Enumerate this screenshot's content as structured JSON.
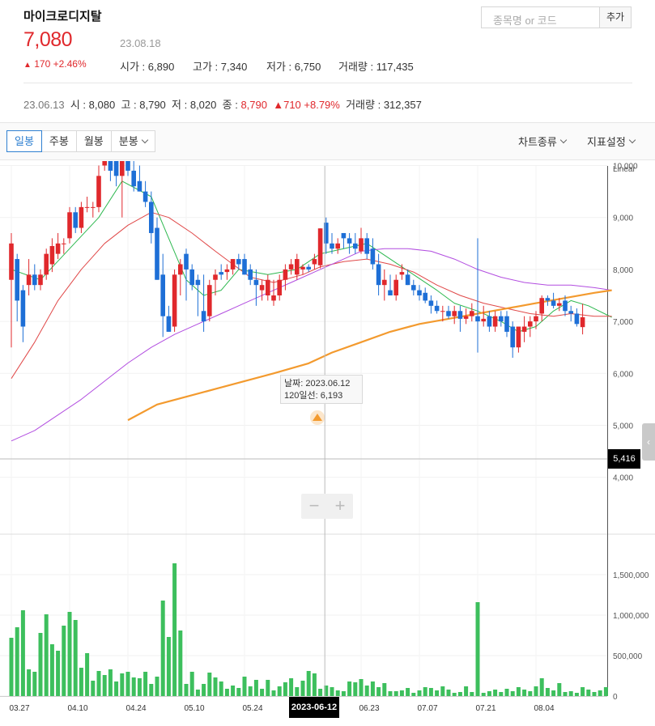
{
  "header": {
    "name": "마이크로디지탈",
    "search_placeholder": "종목명 or 코드",
    "add_label": "추가",
    "price": "7,080",
    "date": "23.08.18",
    "change_arrow": "▲",
    "change": "170 +2.46%",
    "open_label": "시가",
    "open": "6,890",
    "high_label": "고가",
    "high": "7,340",
    "low_label": "저가",
    "low": "6,750",
    "volume_label": "거래량",
    "volume": "117,435"
  },
  "history": {
    "date": "23.06.13",
    "open_label": "시",
    "open": "8,080",
    "high_label": "고",
    "high": "8,790",
    "low_label": "저",
    "low": "8,020",
    "close_label": "종",
    "close": "8,790",
    "change_arrow": "▲",
    "change": "710 +8.79%",
    "volume_label": "거래량",
    "volume": "312,357"
  },
  "toolbar": {
    "tabs": [
      "일봉",
      "주봉",
      "월봉",
      "분봉"
    ],
    "active_tab": 0,
    "chart_type_label": "차트종류",
    "indicator_label": "지표설정"
  },
  "zoom": {
    "minus": "−",
    "plus": "+"
  },
  "side_handle": "‹",
  "tooltip": {
    "date": "날짜: 2023.06.12",
    "value": "120일선: 6,193"
  },
  "crosshair": {
    "x_label": "2023-06-12",
    "y_label": "5,416"
  },
  "colors": {
    "up": "#e0282c",
    "down": "#1e6fd6",
    "volume": "#3dbf5d",
    "ma5": "#2db84f",
    "ma20": "#e04848",
    "ma60": "#b24de0",
    "ma120": "#f39a2e"
  },
  "chart_data": {
    "type": "candlestick",
    "scale_label": "Linear",
    "price_ticks": [
      4000,
      5000,
      6000,
      7000,
      8000,
      9000,
      10000
    ],
    "price_tick_labels": [
      "4,000",
      "5,000",
      "6,000",
      "7,000",
      "8,000",
      "9,000",
      "10,000"
    ],
    "volume_ticks": [
      0,
      500000,
      1000000,
      1500000
    ],
    "volume_tick_labels": [
      "0",
      "500,000",
      "1,000,000",
      "1,500,000"
    ],
    "x_tick_labels": [
      {
        "label": "03.27",
        "index": 0
      },
      {
        "label": "04.10",
        "index": 10
      },
      {
        "label": "04.24",
        "index": 20
      },
      {
        "label": "05.10",
        "index": 30
      },
      {
        "label": "05.24",
        "index": 40
      },
      {
        "label": "06.23",
        "index": 60
      },
      {
        "label": "07.07",
        "index": 70
      },
      {
        "label": "07.21",
        "index": 80
      },
      {
        "label": "08.04",
        "index": 90
      }
    ],
    "crosshair_index": 51,
    "candles": [
      {
        "o": 7800,
        "h": 8700,
        "l": 6500,
        "c": 8500
      },
      {
        "o": 8200,
        "h": 8300,
        "l": 7000,
        "c": 7400
      },
      {
        "o": 7600,
        "h": 7700,
        "l": 6600,
        "c": 6900
      },
      {
        "o": 7700,
        "h": 8200,
        "l": 7500,
        "c": 7900
      },
      {
        "o": 7900,
        "h": 8100,
        "l": 7600,
        "c": 7700
      },
      {
        "o": 7700,
        "h": 8000,
        "l": 7600,
        "c": 7900
      },
      {
        "o": 7900,
        "h": 8400,
        "l": 7800,
        "c": 8300
      },
      {
        "o": 8100,
        "h": 8600,
        "l": 7950,
        "c": 8450
      },
      {
        "o": 8300,
        "h": 8700,
        "l": 8200,
        "c": 8500
      },
      {
        "o": 8500,
        "h": 8600,
        "l": 8300,
        "c": 8500
      },
      {
        "o": 8600,
        "h": 9200,
        "l": 8500,
        "c": 9100
      },
      {
        "o": 9100,
        "h": 9200,
        "l": 8700,
        "c": 8800
      },
      {
        "o": 8800,
        "h": 9300,
        "l": 8700,
        "c": 9200
      },
      {
        "o": 9200,
        "h": 9400,
        "l": 9100,
        "c": 9200
      },
      {
        "o": 9200,
        "h": 9300,
        "l": 9000,
        "c": 9200
      },
      {
        "o": 9200,
        "h": 10000,
        "l": 9100,
        "c": 9800
      },
      {
        "o": 10000,
        "h": 10300,
        "l": 9900,
        "c": 10100
      },
      {
        "o": 10300,
        "h": 10400,
        "l": 9700,
        "c": 9900
      },
      {
        "o": 10100,
        "h": 10200,
        "l": 9600,
        "c": 9800
      },
      {
        "o": 9800,
        "h": 10200,
        "l": 9000,
        "c": 10100
      },
      {
        "o": 10300,
        "h": 10400,
        "l": 9800,
        "c": 9900
      },
      {
        "o": 9900,
        "h": 10100,
        "l": 9500,
        "c": 9600
      },
      {
        "o": 9700,
        "h": 10000,
        "l": 9500,
        "c": 9500
      },
      {
        "o": 9500,
        "h": 9700,
        "l": 9200,
        "c": 9300
      },
      {
        "o": 9300,
        "h": 9500,
        "l": 8500,
        "c": 8700
      },
      {
        "o": 8800,
        "h": 9000,
        "l": 7800,
        "c": 7800
      },
      {
        "o": 7900,
        "h": 8300,
        "l": 6700,
        "c": 7100
      },
      {
        "o": 7100,
        "h": 7300,
        "l": 6800,
        "c": 6800
      },
      {
        "o": 6900,
        "h": 8000,
        "l": 6800,
        "c": 7900
      },
      {
        "o": 7900,
        "h": 8200,
        "l": 7500,
        "c": 8100
      },
      {
        "o": 8300,
        "h": 8400,
        "l": 7400,
        "c": 8000
      },
      {
        "o": 8000,
        "h": 8100,
        "l": 7600,
        "c": 7700
      },
      {
        "o": 7800,
        "h": 7900,
        "l": 7100,
        "c": 7700
      },
      {
        "o": 7200,
        "h": 7900,
        "l": 6800,
        "c": 7000
      },
      {
        "o": 7100,
        "h": 7800,
        "l": 7000,
        "c": 7700
      },
      {
        "o": 7800,
        "h": 8000,
        "l": 7500,
        "c": 7900
      },
      {
        "o": 7950,
        "h": 8100,
        "l": 7800,
        "c": 7900
      },
      {
        "o": 7950,
        "h": 8100,
        "l": 7800,
        "c": 8000
      },
      {
        "o": 8000,
        "h": 8200,
        "l": 7900,
        "c": 8200
      },
      {
        "o": 8200,
        "h": 8300,
        "l": 8000,
        "c": 8100
      },
      {
        "o": 8200,
        "h": 8300,
        "l": 7900,
        "c": 7900
      },
      {
        "o": 8000,
        "h": 8100,
        "l": 7700,
        "c": 7800
      },
      {
        "o": 7800,
        "h": 8000,
        "l": 7300,
        "c": 7700
      },
      {
        "o": 7600,
        "h": 7800,
        "l": 7400,
        "c": 7700
      },
      {
        "o": 7500,
        "h": 7900,
        "l": 7400,
        "c": 7800
      },
      {
        "o": 7400,
        "h": 7800,
        "l": 7300,
        "c": 7500
      },
      {
        "o": 7500,
        "h": 7900,
        "l": 7400,
        "c": 7800
      },
      {
        "o": 7800,
        "h": 8100,
        "l": 7600,
        "c": 8000
      },
      {
        "o": 8000,
        "h": 8200,
        "l": 7900,
        "c": 8100
      },
      {
        "o": 7900,
        "h": 8300,
        "l": 7800,
        "c": 8200
      },
      {
        "o": 8000,
        "h": 8100,
        "l": 7900,
        "c": 8050
      },
      {
        "o": 8050,
        "h": 8100,
        "l": 7950,
        "c": 8000
      },
      {
        "o": 8100,
        "h": 8300,
        "l": 8000,
        "c": 8200
      },
      {
        "o": 8080,
        "h": 8790,
        "l": 8020,
        "c": 8790
      },
      {
        "o": 8900,
        "h": 9000,
        "l": 8300,
        "c": 8500
      },
      {
        "o": 8500,
        "h": 8700,
        "l": 8300,
        "c": 8400
      },
      {
        "o": 8400,
        "h": 8600,
        "l": 8300,
        "c": 8500
      },
      {
        "o": 8700,
        "h": 8700,
        "l": 8400,
        "c": 8600
      },
      {
        "o": 8600,
        "h": 8700,
        "l": 8300,
        "c": 8500
      },
      {
        "o": 8500,
        "h": 8700,
        "l": 8300,
        "c": 8400
      },
      {
        "o": 8350,
        "h": 8800,
        "l": 8300,
        "c": 8600
      },
      {
        "o": 8600,
        "h": 8700,
        "l": 8200,
        "c": 8300
      },
      {
        "o": 8400,
        "h": 8600,
        "l": 8000,
        "c": 8100
      },
      {
        "o": 8100,
        "h": 8300,
        "l": 7500,
        "c": 7700
      },
      {
        "o": 7700,
        "h": 8000,
        "l": 7400,
        "c": 7800
      },
      {
        "o": 7600,
        "h": 7900,
        "l": 7500,
        "c": 7500
      },
      {
        "o": 7500,
        "h": 7900,
        "l": 7400,
        "c": 7800
      },
      {
        "o": 7900,
        "h": 8100,
        "l": 7800,
        "c": 7950
      },
      {
        "o": 7900,
        "h": 8000,
        "l": 7700,
        "c": 7700
      },
      {
        "o": 7700,
        "h": 7800,
        "l": 7500,
        "c": 7600
      },
      {
        "o": 7600,
        "h": 7700,
        "l": 7400,
        "c": 7500
      },
      {
        "o": 7550,
        "h": 7650,
        "l": 7350,
        "c": 7400
      },
      {
        "o": 7400,
        "h": 7500,
        "l": 7150,
        "c": 7300
      },
      {
        "o": 7300,
        "h": 7400,
        "l": 7150,
        "c": 7200
      },
      {
        "o": 7200,
        "h": 7300,
        "l": 7000,
        "c": 7200
      },
      {
        "o": 7200,
        "h": 7300,
        "l": 7050,
        "c": 7100
      },
      {
        "o": 7100,
        "h": 7300,
        "l": 6950,
        "c": 7200
      },
      {
        "o": 7200,
        "h": 7300,
        "l": 6800,
        "c": 7050
      },
      {
        "o": 7050,
        "h": 7250,
        "l": 6950,
        "c": 7100
      },
      {
        "o": 7100,
        "h": 7350,
        "l": 7000,
        "c": 7200
      },
      {
        "o": 7100,
        "h": 8600,
        "l": 6400,
        "c": 7000
      },
      {
        "o": 7000,
        "h": 7300,
        "l": 6900,
        "c": 7050
      },
      {
        "o": 7100,
        "h": 7200,
        "l": 6800,
        "c": 6900
      },
      {
        "o": 6900,
        "h": 7200,
        "l": 6800,
        "c": 7100
      },
      {
        "o": 7100,
        "h": 7200,
        "l": 6900,
        "c": 7000
      },
      {
        "o": 7100,
        "h": 7200,
        "l": 6700,
        "c": 6800
      },
      {
        "o": 6900,
        "h": 7000,
        "l": 6300,
        "c": 6500
      },
      {
        "o": 6500,
        "h": 6900,
        "l": 6400,
        "c": 6900
      },
      {
        "o": 6800,
        "h": 7100,
        "l": 6600,
        "c": 6900
      },
      {
        "o": 6900,
        "h": 7100,
        "l": 6700,
        "c": 7000
      },
      {
        "o": 7000,
        "h": 7200,
        "l": 6850,
        "c": 7100
      },
      {
        "o": 7150,
        "h": 7500,
        "l": 7000,
        "c": 7450
      },
      {
        "o": 7450,
        "h": 7500,
        "l": 7300,
        "c": 7400
      },
      {
        "o": 7400,
        "h": 7550,
        "l": 7250,
        "c": 7300
      },
      {
        "o": 7300,
        "h": 7450,
        "l": 7200,
        "c": 7350
      },
      {
        "o": 7400,
        "h": 7500,
        "l": 7100,
        "c": 7200
      },
      {
        "o": 7200,
        "h": 7300,
        "l": 7000,
        "c": 7150
      },
      {
        "o": 7150,
        "h": 7250,
        "l": 6900,
        "c": 6950
      },
      {
        "o": 6890,
        "h": 7340,
        "l": 6750,
        "c": 7080
      }
    ],
    "volume": [
      720000,
      850000,
      1060000,
      330000,
      300000,
      780000,
      1010000,
      640000,
      560000,
      870000,
      1040000,
      940000,
      350000,
      530000,
      190000,
      310000,
      260000,
      330000,
      180000,
      280000,
      300000,
      230000,
      220000,
      300000,
      150000,
      240000,
      1180000,
      730000,
      1640000,
      810000,
      150000,
      300000,
      80000,
      150000,
      290000,
      230000,
      180000,
      90000,
      130000,
      100000,
      240000,
      120000,
      200000,
      90000,
      200000,
      70000,
      120000,
      170000,
      220000,
      110000,
      190000,
      310000,
      280000,
      90000,
      130000,
      110000,
      70000,
      60000,
      180000,
      170000,
      210000,
      130000,
      180000,
      110000,
      160000,
      60000,
      60000,
      70000,
      100000,
      40000,
      70000,
      110000,
      100000,
      70000,
      120000,
      80000,
      40000,
      50000,
      120000,
      50000,
      1160000,
      40000,
      60000,
      80000,
      50000,
      90000,
      60000,
      110000,
      80000,
      60000,
      120000,
      220000,
      100000,
      70000,
      160000,
      50000,
      60000,
      40000,
      110000,
      80000,
      50000,
      70000,
      110000
    ],
    "moving_averages": [
      {
        "name": "MA5",
        "points": [
          [
            0,
            8000
          ],
          [
            5,
            7800
          ],
          [
            10,
            8400
          ],
          [
            15,
            9000
          ],
          [
            19,
            9700
          ],
          [
            24,
            9400
          ],
          [
            27,
            8600
          ],
          [
            30,
            7800
          ],
          [
            33,
            7500
          ],
          [
            36,
            7600
          ],
          [
            39,
            8000
          ],
          [
            44,
            7900
          ],
          [
            49,
            8000
          ],
          [
            53,
            8300
          ],
          [
            57,
            8400
          ],
          [
            61,
            8500
          ],
          [
            65,
            8200
          ],
          [
            69,
            7900
          ],
          [
            73,
            7600
          ],
          [
            76,
            7350
          ],
          [
            80,
            7200
          ],
          [
            84,
            7000
          ],
          [
            87,
            6800
          ],
          [
            90,
            6900
          ],
          [
            93,
            7200
          ],
          [
            96,
            7400
          ],
          [
            99,
            7300
          ],
          [
            103,
            7080
          ]
        ]
      },
      {
        "name": "MA20",
        "points": [
          [
            0,
            5900
          ],
          [
            4,
            6600
          ],
          [
            8,
            7400
          ],
          [
            12,
            8000
          ],
          [
            16,
            8500
          ],
          [
            20,
            8850
          ],
          [
            24,
            9100
          ],
          [
            27,
            9000
          ],
          [
            31,
            8700
          ],
          [
            35,
            8350
          ],
          [
            38,
            8100
          ],
          [
            41,
            7850
          ],
          [
            45,
            7750
          ],
          [
            50,
            7900
          ],
          [
            53,
            8050
          ],
          [
            57,
            8150
          ],
          [
            61,
            8200
          ],
          [
            65,
            8100
          ],
          [
            69,
            7950
          ],
          [
            73,
            7700
          ],
          [
            77,
            7500
          ],
          [
            81,
            7350
          ],
          [
            85,
            7250
          ],
          [
            89,
            7150
          ],
          [
            93,
            7100
          ],
          [
            96,
            7150
          ],
          [
            100,
            7100
          ],
          [
            103,
            7100
          ]
        ]
      },
      {
        "name": "MA60",
        "points": [
          [
            0,
            4700
          ],
          [
            4,
            4900
          ],
          [
            8,
            5200
          ],
          [
            12,
            5500
          ],
          [
            16,
            5850
          ],
          [
            20,
            6200
          ],
          [
            24,
            6500
          ],
          [
            28,
            6750
          ],
          [
            32,
            6950
          ],
          [
            36,
            7150
          ],
          [
            40,
            7350
          ],
          [
            44,
            7550
          ],
          [
            48,
            7750
          ],
          [
            52,
            7950
          ],
          [
            56,
            8150
          ],
          [
            60,
            8350
          ],
          [
            64,
            8400
          ],
          [
            68,
            8400
          ],
          [
            72,
            8350
          ],
          [
            76,
            8200
          ],
          [
            80,
            8000
          ],
          [
            84,
            7850
          ],
          [
            88,
            7750
          ],
          [
            92,
            7700
          ],
          [
            96,
            7700
          ],
          [
            100,
            7650
          ],
          [
            103,
            7600
          ]
        ]
      },
      {
        "name": "MA120",
        "points": [
          [
            20,
            5100
          ],
          [
            25,
            5400
          ],
          [
            30,
            5550
          ],
          [
            35,
            5700
          ],
          [
            40,
            5850
          ],
          [
            45,
            6000
          ],
          [
            51,
            6193
          ],
          [
            55,
            6400
          ],
          [
            60,
            6600
          ],
          [
            65,
            6800
          ],
          [
            70,
            6950
          ],
          [
            75,
            7050
          ],
          [
            80,
            7150
          ],
          [
            85,
            7250
          ],
          [
            90,
            7350
          ],
          [
            95,
            7450
          ],
          [
            100,
            7550
          ],
          [
            103,
            7600
          ]
        ]
      }
    ]
  }
}
